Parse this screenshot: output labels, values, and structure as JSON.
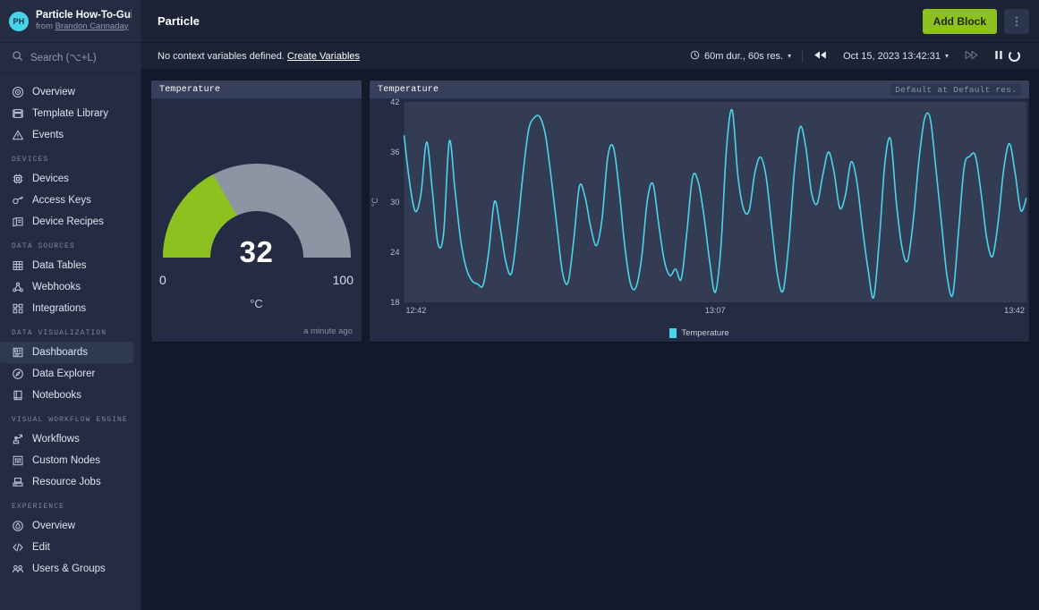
{
  "sidebar": {
    "brand": {
      "avatar_initials": "PH",
      "title": "Particle How-To-Guide",
      "from_prefix": "from ",
      "owner": "Brandon Cannaday"
    },
    "search": {
      "placeholder": "Search (⌥+L)",
      "value": "",
      "icon": "search-icon"
    },
    "groups": [
      {
        "label": "",
        "items": [
          {
            "label": "Overview",
            "icon": "target-icon",
            "active": false
          },
          {
            "label": "Template Library",
            "icon": "library-icon",
            "active": false
          },
          {
            "label": "Events",
            "icon": "warning-triangle-icon",
            "active": false
          }
        ]
      },
      {
        "label": "DEVICES",
        "items": [
          {
            "label": "Devices",
            "icon": "chip-icon",
            "active": false
          },
          {
            "label": "Access Keys",
            "icon": "key-icon",
            "active": false
          },
          {
            "label": "Device Recipes",
            "icon": "recipe-icon",
            "active": false
          }
        ]
      },
      {
        "label": "DATA SOURCES",
        "items": [
          {
            "label": "Data Tables",
            "icon": "table-grid-icon",
            "active": false
          },
          {
            "label": "Webhooks",
            "icon": "webhook-icon",
            "active": false
          },
          {
            "label": "Integrations",
            "icon": "integrations-icon",
            "active": false
          }
        ]
      },
      {
        "label": "DATA VISUALIZATION",
        "items": [
          {
            "label": "Dashboards",
            "icon": "dashboard-icon",
            "active": true
          },
          {
            "label": "Data Explorer",
            "icon": "compass-icon",
            "active": false
          },
          {
            "label": "Notebooks",
            "icon": "notebook-icon",
            "active": false
          }
        ]
      },
      {
        "label": "VISUAL WORKFLOW ENGINE",
        "items": [
          {
            "label": "Workflows",
            "icon": "workflow-icon",
            "active": false
          },
          {
            "label": "Custom Nodes",
            "icon": "sliders-icon",
            "active": false
          },
          {
            "label": "Resource Jobs",
            "icon": "server-icon",
            "active": false
          }
        ]
      },
      {
        "label": "EXPERIENCE",
        "items": [
          {
            "label": "Overview",
            "icon": "drop-icon",
            "active": false
          },
          {
            "label": "Edit",
            "icon": "code-icon",
            "active": false
          },
          {
            "label": "Users & Groups",
            "icon": "users-icon",
            "active": false
          }
        ]
      }
    ]
  },
  "topbar": {
    "title": "Particle",
    "add_block_label": "Add Block",
    "kebab_label": "More options"
  },
  "subbar": {
    "context_message": "No context variables defined. ",
    "create_variables_link": "Create Variables",
    "duration_label": "60m dur., 60s res.",
    "timestamp": "Oct 15, 2023 13:42:31",
    "caret": "▾",
    "rewind_icon": "rewind-icon",
    "forward_icon": "fast-forward-icon",
    "pause_icon": "pause-icon",
    "loading_icon": "loading-spinner-icon",
    "clock_icon": "clock-icon"
  },
  "blocks": {
    "gauge": {
      "title": "Temperature",
      "value": "32",
      "min_label": "0",
      "max_label": "100",
      "unit": "°C",
      "timestamp": "a minute ago",
      "fill_color": "#8cc11f",
      "track_color": "#8d95a5",
      "value_number": 32,
      "min": 0,
      "max": 100
    },
    "chart": {
      "title": "Temperature",
      "badge": "Default at Default res.",
      "legend": "Temperature",
      "series_color": "#4ad4ea"
    }
  },
  "chart_data": {
    "type": "line",
    "title": "Temperature",
    "xlabel": "",
    "ylabel": "°C",
    "ylim": [
      18,
      42
    ],
    "yticks": [
      18,
      24,
      30,
      36,
      42
    ],
    "xticks": [
      "12:42",
      "13:07",
      "13:42"
    ],
    "xlim": [
      "12:42",
      "13:42"
    ],
    "grid": false,
    "legend_position": "bottom",
    "series": [
      {
        "name": "Temperature",
        "color": "#4ad4ea",
        "values": [
          38.0,
          32.3,
          28.9,
          31.0,
          37.2,
          31.4,
          25.0,
          26.3,
          37.3,
          31.5,
          25.5,
          22.1,
          20.6,
          20.2,
          20.1,
          24.2,
          30.1,
          26.9,
          22.8,
          21.5,
          26.5,
          33.2,
          38.6,
          40.1,
          40.2,
          38.0,
          33.0,
          27.2,
          21.6,
          20.4,
          25.5,
          31.9,
          30.6,
          27.0,
          24.8,
          28.0,
          35.4,
          36.6,
          31.6,
          24.8,
          20.3,
          19.8,
          23.4,
          30.2,
          32.2,
          27.4,
          23.0,
          21.2,
          22.0,
          20.8,
          26.5,
          33.0,
          32.4,
          28.4,
          23.0,
          19.2,
          24.6,
          36.5,
          41.0,
          33.2,
          29.2,
          29.0,
          33.5,
          35.4,
          33.0,
          27.0,
          21.3,
          19.4,
          25.0,
          33.8,
          39.0,
          36.6,
          31.2,
          29.8,
          33.2,
          36.0,
          33.6,
          29.3,
          30.8,
          34.8,
          32.6,
          27.0,
          22.0,
          18.6,
          25.5,
          34.8,
          37.5,
          30.0,
          24.6,
          23.0,
          27.8,
          35.0,
          40.0,
          40.0,
          34.0,
          27.4,
          21.0,
          19.0,
          26.5,
          34.2,
          35.5,
          35.5,
          31.0,
          25.6,
          23.5,
          27.6,
          34.0,
          37.0,
          33.5,
          29.0,
          30.5
        ]
      }
    ]
  }
}
